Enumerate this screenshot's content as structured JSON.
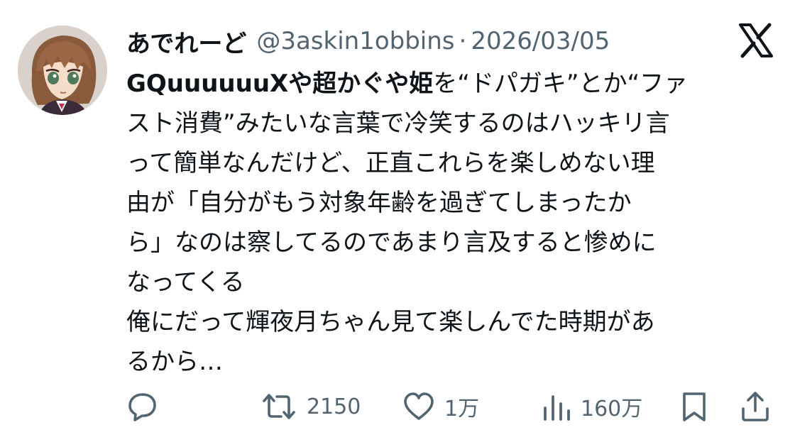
{
  "tweet": {
    "author": {
      "display_name": "あでれーど",
      "handle": "@3askin1obbins",
      "avatar_icon": "anime-character-avatar-icon"
    },
    "separator": "·",
    "timestamp": "2026/03/05",
    "platform_logo": "x-logo-icon",
    "text_lines": [
      {
        "parts": [
          "GQuuuuuuX",
          "や",
          "超かぐや姫",
          "を“ドパガキ”とか“ファ"
        ]
      },
      {
        "text": "スト消費”みたいな言葉で冷笑するのはハッキリ言"
      },
      {
        "text": "って簡単なんだけど、正直これらを楽しめない理"
      },
      {
        "text": "由が「自分がもう対象年齢を過ぎてしまったか"
      },
      {
        "text": "ら」なのは察してるのであまり言及すると惨めに"
      },
      {
        "text": "なってくる"
      },
      {
        "text": "俺にだって輝夜月ちゃん見て楽しんでた時期があ"
      },
      {
        "text": "るから…"
      }
    ],
    "actions": {
      "reply": {
        "icon": "reply-bubble-icon",
        "count": ""
      },
      "retweet": {
        "icon": "retweet-icon",
        "count": "2150"
      },
      "like": {
        "icon": "heart-icon",
        "count": "1万"
      },
      "views": {
        "icon": "analytics-bars-icon",
        "count": "160万"
      },
      "bookmark": {
        "icon": "bookmark-icon"
      },
      "share": {
        "icon": "share-upload-icon"
      }
    },
    "colors": {
      "text": "#0f1419",
      "secondary": "#536471"
    }
  }
}
